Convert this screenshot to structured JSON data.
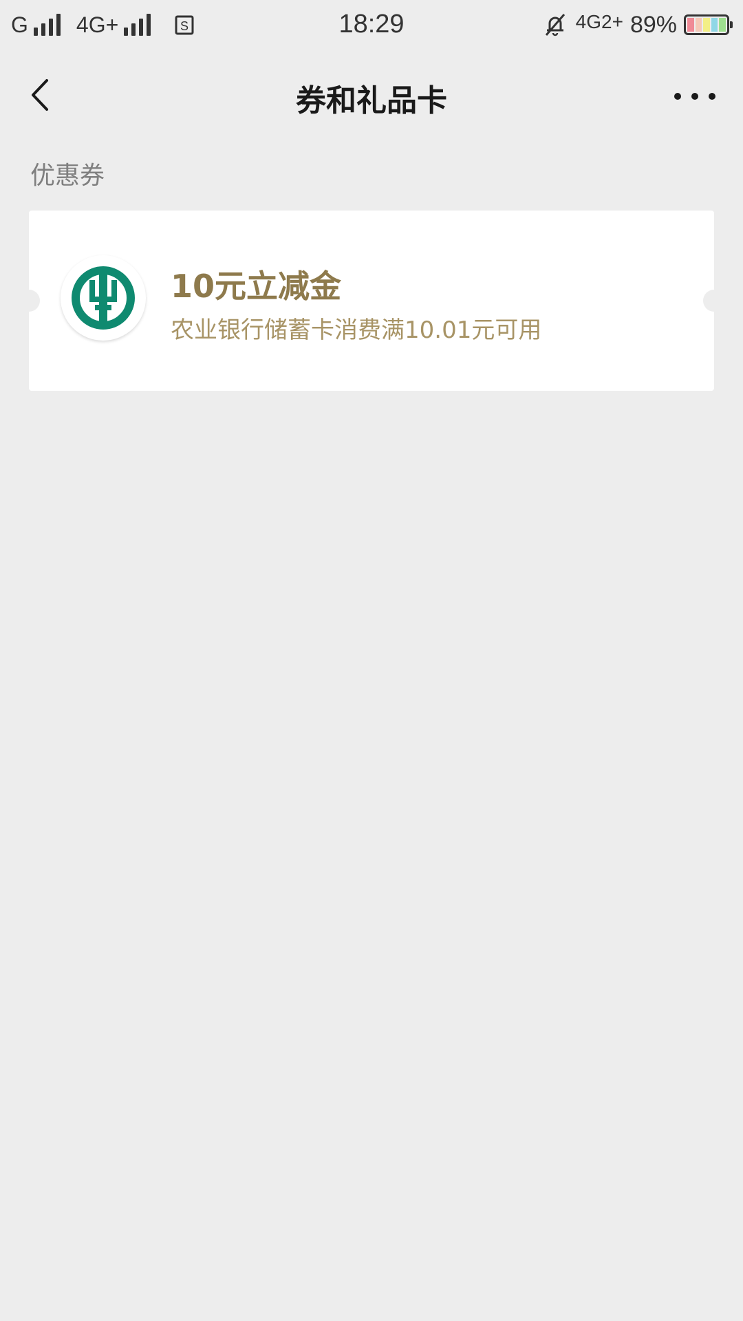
{
  "status_bar": {
    "carrier1": "G",
    "carrier2": "4G+",
    "time": "18:29",
    "network": "4G2+",
    "battery": "89%"
  },
  "header": {
    "title": "券和礼品卡"
  },
  "section": {
    "title": "优惠券"
  },
  "coupon": {
    "title": "10元立减金",
    "description": "农业银行储蓄卡消费满10.01元可用"
  },
  "colors": {
    "background": "#ededed",
    "card": "#ffffff",
    "coupon_title": "#8e7a4c",
    "coupon_desc": "#a89466",
    "bank_logo": "#0f8a70"
  },
  "icons": {
    "back": "back-arrow-icon",
    "more": "more-dots-icon",
    "logo": "abc-bank-logo-icon"
  }
}
